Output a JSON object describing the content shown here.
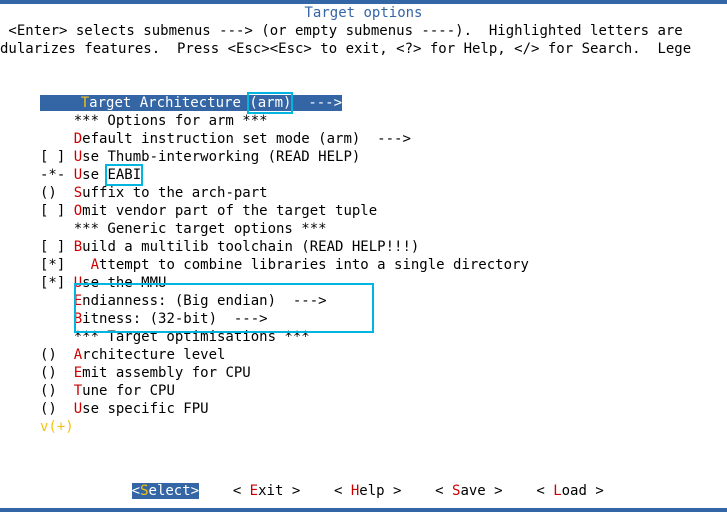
{
  "title": "Target options",
  "help_line1": " <Enter> selects submenus ---> (or empty submenus ----).  Highlighted letters are ",
  "help_line2": "dularizes features.  Press <Esc><Esc> to exit, <?> for Help, </> for Search.  Lege",
  "rows": [
    {
      "prefix": "    ",
      "hot": "T",
      "rest": "arget Architecture ",
      "value": "(arm)",
      "arrow": "  --->",
      "selected": true,
      "box_value": true
    },
    {
      "prefix": "    ",
      "hot": "",
      "rest": "*** Options for arm ***"
    },
    {
      "prefix": "    ",
      "hot": "D",
      "rest": "efault instruction set mode (arm)  --->"
    },
    {
      "prefix": "[ ] ",
      "hot": "U",
      "rest": "se Thumb-interworking (READ HELP)"
    },
    {
      "prefix": "-*- ",
      "hot": "U",
      "rest": "se ",
      "value": "EABI",
      "box_value": true
    },
    {
      "prefix": "()  ",
      "hot": "S",
      "rest": "uffix to the arch-part"
    },
    {
      "prefix": "[ ] ",
      "hot": "O",
      "rest": "mit vendor part of the target tuple"
    },
    {
      "prefix": "    ",
      "hot": "",
      "rest": "*** Generic target options ***"
    },
    {
      "prefix": "[ ] ",
      "hot": "B",
      "rest": "uild a multilib toolchain (READ HELP!!!)"
    },
    {
      "prefix": "[*]   ",
      "hot": "A",
      "rest": "ttempt to combine libraries into a single directory"
    },
    {
      "prefix": "[*] ",
      "hot": "U",
      "rest": "se the MMU",
      "box_row": true
    },
    {
      "prefix": "    ",
      "hot": "E",
      "rest": "ndianness: (Big endian)  --->",
      "box_row": true
    },
    {
      "prefix": "    ",
      "hot": "B",
      "rest": "itness: (32-bit)  --->",
      "box_row": true
    },
    {
      "prefix": "    ",
      "hot": "",
      "rest": "*** Target optimisations ***"
    },
    {
      "prefix": "()  ",
      "hot": "A",
      "rest": "rchitecture level"
    },
    {
      "prefix": "()  ",
      "hot": "E",
      "rest": "mit assembly for CPU"
    },
    {
      "prefix": "()  ",
      "hot": "T",
      "rest": "une for CPU"
    },
    {
      "prefix": "()  ",
      "hot": "U",
      "rest": "se specific FPU"
    }
  ],
  "more": "v(+)",
  "buttons": {
    "select": {
      "pre": "<",
      "hot": "S",
      "post": "elect>"
    },
    "exit": {
      "pre": "< ",
      "hot": "E",
      "post": "xit > "
    },
    "help": {
      "pre": "< ",
      "hot": "H",
      "post": "elp > "
    },
    "save": {
      "pre": "< ",
      "hot": "S",
      "post": "ave > "
    },
    "load": {
      "pre": "< ",
      "hot": "L",
      "post": "oad > "
    }
  }
}
